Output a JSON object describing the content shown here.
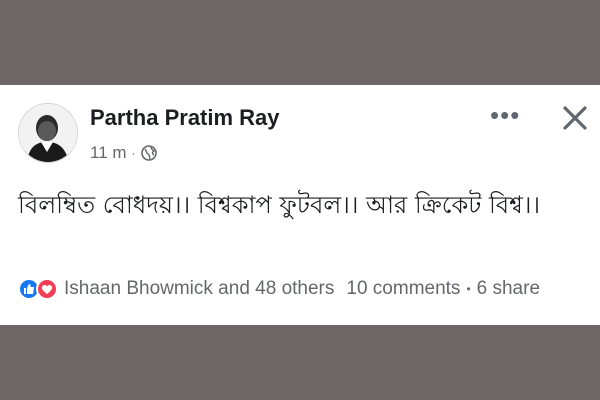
{
  "post": {
    "author": "Partha Pratim Ray",
    "time": "11 m",
    "privacy_icon": "globe-icon",
    "text": "বিলম্বিত বোধদয়।।  বিশ্বকাপ ফুটবল।। আর ক্রিকেট বিশ্ব।।",
    "reactions": [
      "like-icon",
      "love-icon"
    ],
    "reactors": "Ishaan Bhowmick and 48 others",
    "comments": "10 comments",
    "shares": "6 share",
    "colors": {
      "like": "#1877f2",
      "love": "#f33e58",
      "backdrop": "#6f6767"
    }
  }
}
